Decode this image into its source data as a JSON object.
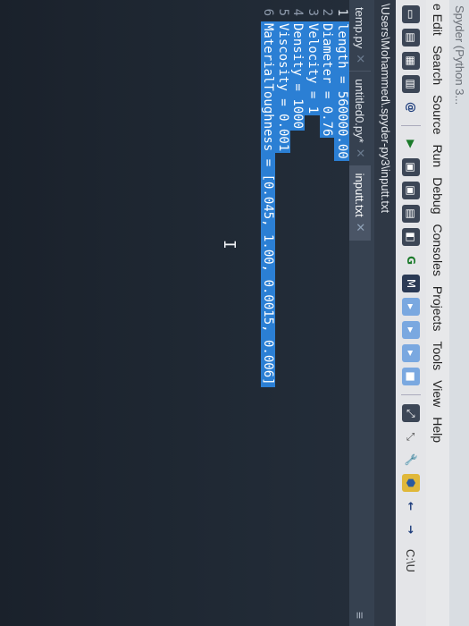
{
  "window": {
    "title": "Spyder (Python 3..."
  },
  "menu": [
    "e Edit",
    "Search",
    "Source",
    "Run",
    "Debug",
    "Consoles",
    "Projects",
    "Tools",
    "View",
    "Help"
  ],
  "toolbar": {
    "icons": [
      "new-file",
      "open-folder",
      "save",
      "save-all",
      "at",
      "play",
      "run-cell",
      "run-cell-advance",
      "run-selection",
      "debug",
      "step",
      "stop",
      "ide-sep",
      "max",
      "tools",
      "python",
      "back",
      "forward"
    ],
    "path_short": "C:\\U"
  },
  "path": "\\Users\\Mohammed\\.spyder-py3\\inputt.txt",
  "tabs": [
    {
      "label": "temp.py",
      "active": false
    },
    {
      "label": "untitled0.py*",
      "active": false
    },
    {
      "label": "inputt.txt",
      "active": true
    }
  ],
  "editor": {
    "lines": [
      {
        "n": "1",
        "text": "length = 560000.00"
      },
      {
        "n": "2",
        "text": "Diameter = 0.76"
      },
      {
        "n": "3",
        "text": "Velocity = 1"
      },
      {
        "n": "4",
        "text": "Density = 1000"
      },
      {
        "n": "5",
        "text": "Viscosity = 0.001"
      },
      {
        "n": "6",
        "text": "MaterialToughness = [0.045, 1.00, 0.0015, 0.006]"
      }
    ]
  },
  "colors": {
    "selection": "#2b7fd4",
    "editor_bg": "#1f2833",
    "tab_active": "#4a5566"
  }
}
